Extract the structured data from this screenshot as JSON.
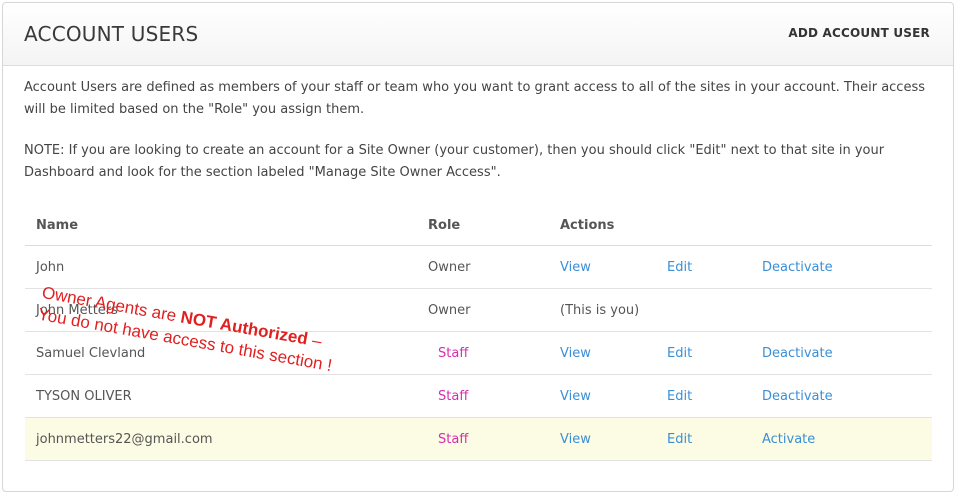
{
  "header": {
    "title": "ACCOUNT USERS",
    "add_button": "ADD ACCOUNT USER"
  },
  "description": {
    "intro": "Account Users are defined as members of your staff or team who you want to grant access to all of the sites in your account. Their access will be limited based on the \"Role\" you assign them.",
    "note": "NOTE: If you are looking to create an account for a Site Owner (your customer), then you should click \"Edit\" next to that site in your Dashboard and look for the section labeled \"Manage Site Owner Access\"."
  },
  "table": {
    "headers": {
      "name": "Name",
      "role": "Role",
      "actions": "Actions"
    },
    "rows": [
      {
        "name": "John",
        "role": "Owner",
        "view": "View",
        "edit": "Edit",
        "status_action": "Deactivate"
      },
      {
        "name": "John Metters",
        "role": "Owner",
        "note": "(This is you)"
      },
      {
        "name": "Samuel Clevland",
        "role": "Staff",
        "view": "View",
        "edit": "Edit",
        "status_action": "Deactivate"
      },
      {
        "name": "TYSON OLIVER",
        "role": "Staff",
        "view": "View",
        "edit": "Edit",
        "status_action": "Deactivate"
      },
      {
        "name": "johnmetters22@gmail.com",
        "role": "Staff",
        "view": "View",
        "edit": "Edit",
        "status_action": "Activate"
      }
    ]
  },
  "overlay": {
    "line1_prefix": "Owner Agents are ",
    "line1_bold": "NOT Authorized",
    "line1_suffix": " –",
    "line2": "You do not have access to this section !"
  },
  "colors": {
    "link": "#3a8fd6",
    "staff_role": "#d62fae",
    "highlight_row": "#fcfbe3",
    "overlay_text": "#e02020"
  }
}
